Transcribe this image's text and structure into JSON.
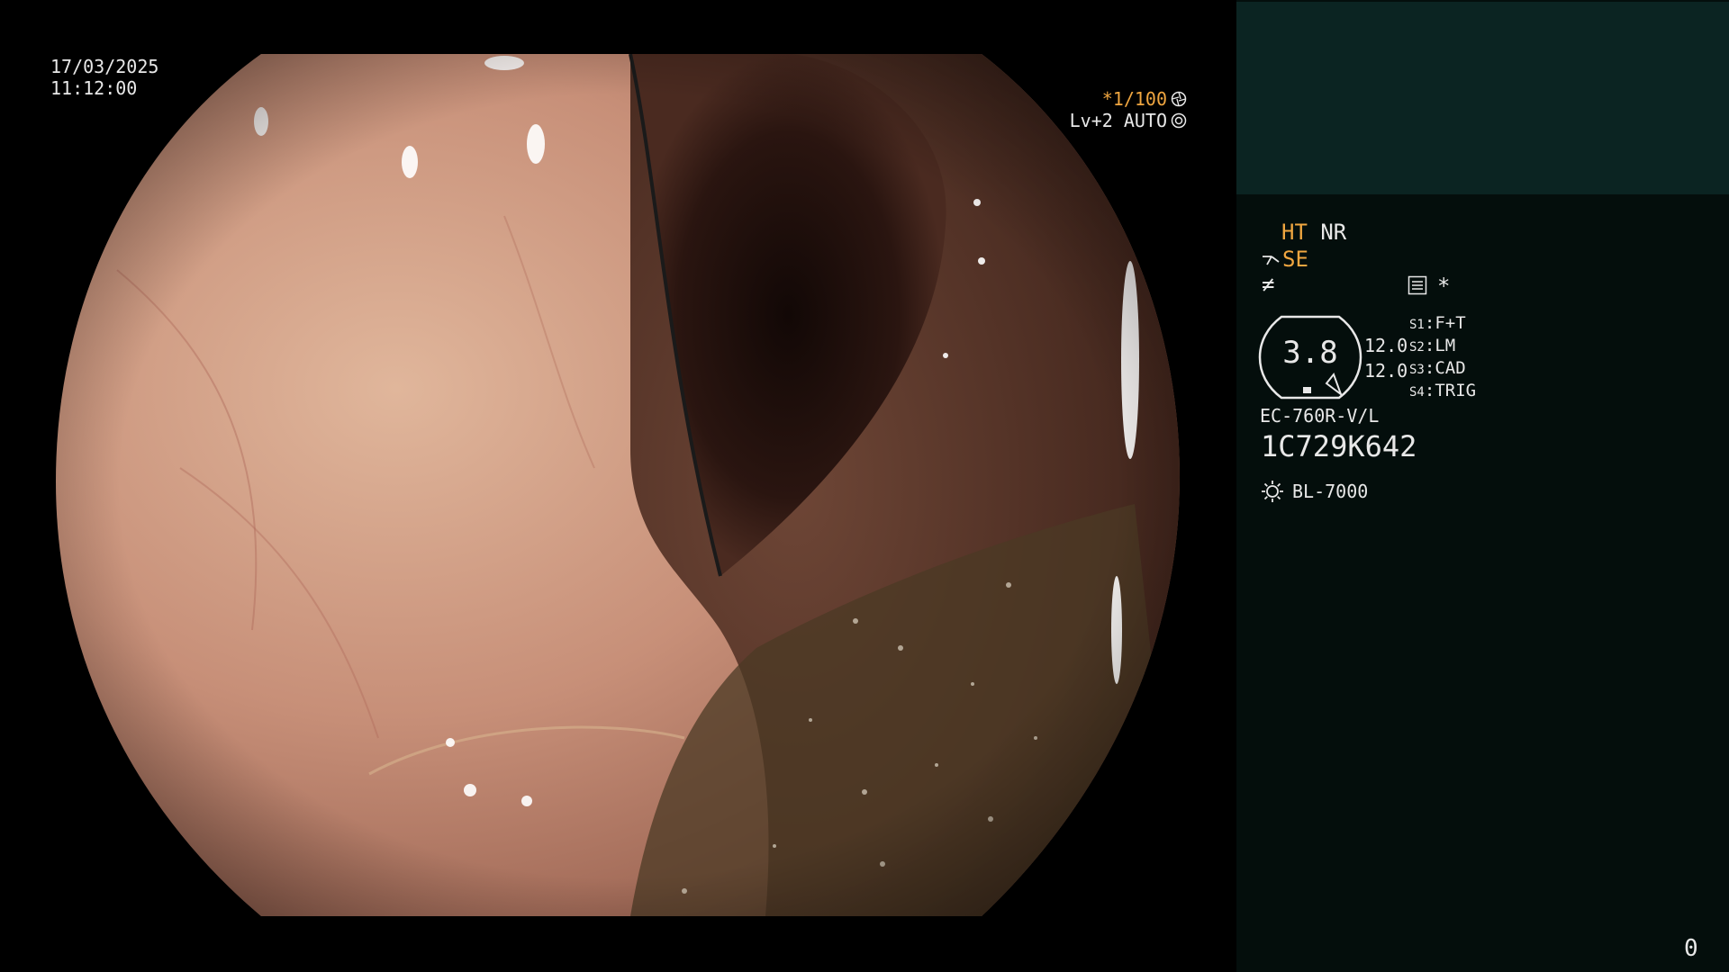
{
  "overlay": {
    "date": "17/03/2025",
    "time": "11:12:00",
    "shutter": "*1/100",
    "iris": "Lv+2 AUTO"
  },
  "side_panel": {
    "mode_ht": "HT",
    "mode_nr": "NR",
    "mode_se": "SE",
    "mode_f": "≠",
    "star": "*",
    "gauge_value": "3.8",
    "setting_value_1": "12.0",
    "setting_value_2": "12.0",
    "switches": [
      {
        "key": "S1",
        "value": "F+T"
      },
      {
        "key": "S2",
        "value": "LM"
      },
      {
        "key": "S3",
        "value": "CAD"
      },
      {
        "key": "S4",
        "value": "TRIG"
      }
    ],
    "scope_model": "EC-760R-V/L",
    "serial": "1C729K642",
    "light_source": "BL-7000"
  },
  "counter": "0",
  "colors": {
    "accent_orange": "#f0a640",
    "panel_top": "#0b2422",
    "panel_bg": "#040e0c"
  }
}
